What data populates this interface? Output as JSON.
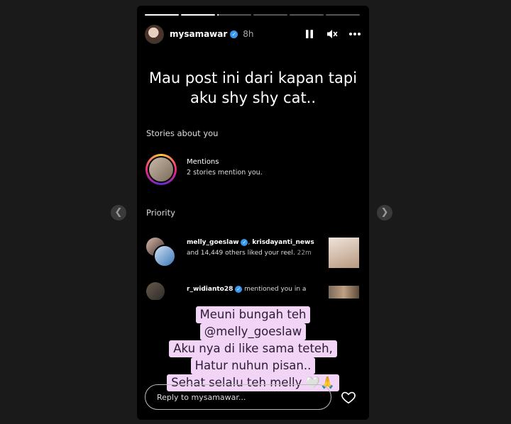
{
  "story": {
    "progress": [
      1,
      1,
      0.05,
      0,
      0,
      0
    ],
    "username": "mysamawar",
    "time": "8h",
    "caption_lines": [
      "Mau post ini dari kapan tapi",
      "aku shy shy cat.."
    ]
  },
  "screenshot": {
    "section_stories": "Stories about you",
    "mentions_title": "Mentions",
    "mentions_sub": "2 stories mention you.",
    "section_priority": "Priority",
    "rows": [
      {
        "user1": "melly_goeslaw",
        "sep": ", ",
        "user2": "krisdayanti_news",
        "text": "and 14,449 others liked your reel.",
        "time": "22m"
      },
      {
        "user1": "r_widianto28",
        "text": "mentioned you in a"
      }
    ]
  },
  "sticker_lines": [
    "Meuni bungah teh",
    "@melly_goeslaw",
    "Aku nya di like sama teteh,",
    "Hatur nuhun pisan..",
    "Sehat selalu teh melly 🤍🙏"
  ],
  "reply_placeholder": "Reply to mysamawar...",
  "icons": {
    "nav_prev": "chevron-left-icon",
    "nav_next": "chevron-right-icon",
    "pause": "pause-icon",
    "mute": "mute-icon",
    "more": "more-icon",
    "heart": "heart-icon"
  }
}
